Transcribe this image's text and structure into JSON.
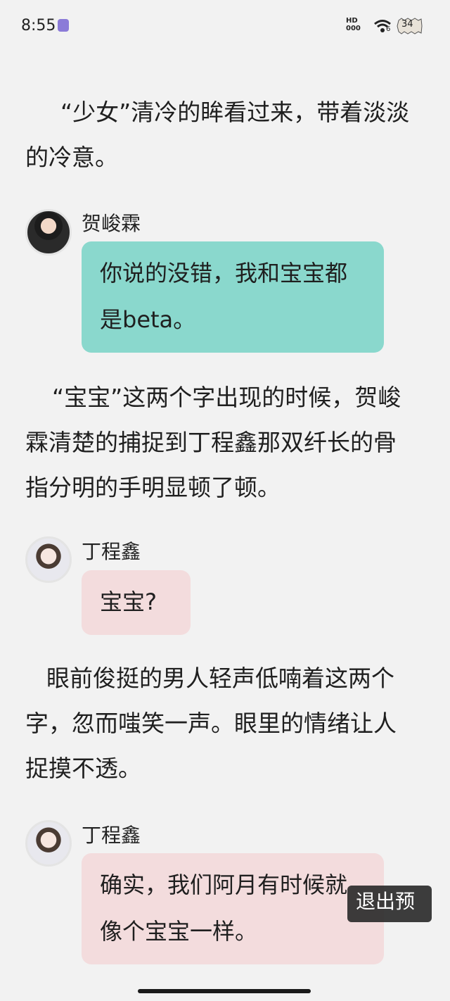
{
  "status_bar": {
    "time": "8:55",
    "hd_line1": "HD",
    "hd_line2": "000",
    "wifi_badge": "6",
    "battery": "34"
  },
  "story": [
    {
      "kind": "para",
      "text": "“少女”清冷的眸看过来，带着淡淡的冷意。"
    },
    {
      "kind": "msg",
      "speaker": "贺峻霖",
      "text": "你说的没错，我和宝宝都是beta。",
      "bubble_color": "#8ad8cd"
    },
    {
      "kind": "para",
      "text": "“宝宝”这两个字出现的时候，贺峻霖清楚的捕捉到丁程鑫那双纤长的骨指分明的手明显顿了顿。"
    },
    {
      "kind": "msg",
      "speaker": "丁程鑫",
      "text": "宝宝?",
      "bubble_color": "#f3dcdd"
    },
    {
      "kind": "para",
      "text": "眼前俊挺的男人轻声低喃着这两个字，忽而嗤笑一声。眼里的情绪让人捉摸不透。"
    },
    {
      "kind": "msg",
      "speaker": "丁程鑫",
      "text": "确实，我们阿月有时候就像个宝宝一样。",
      "bubble_color": "#f3dcdd"
    }
  ],
  "overlay": {
    "exit_preview_label": "退出预览"
  }
}
